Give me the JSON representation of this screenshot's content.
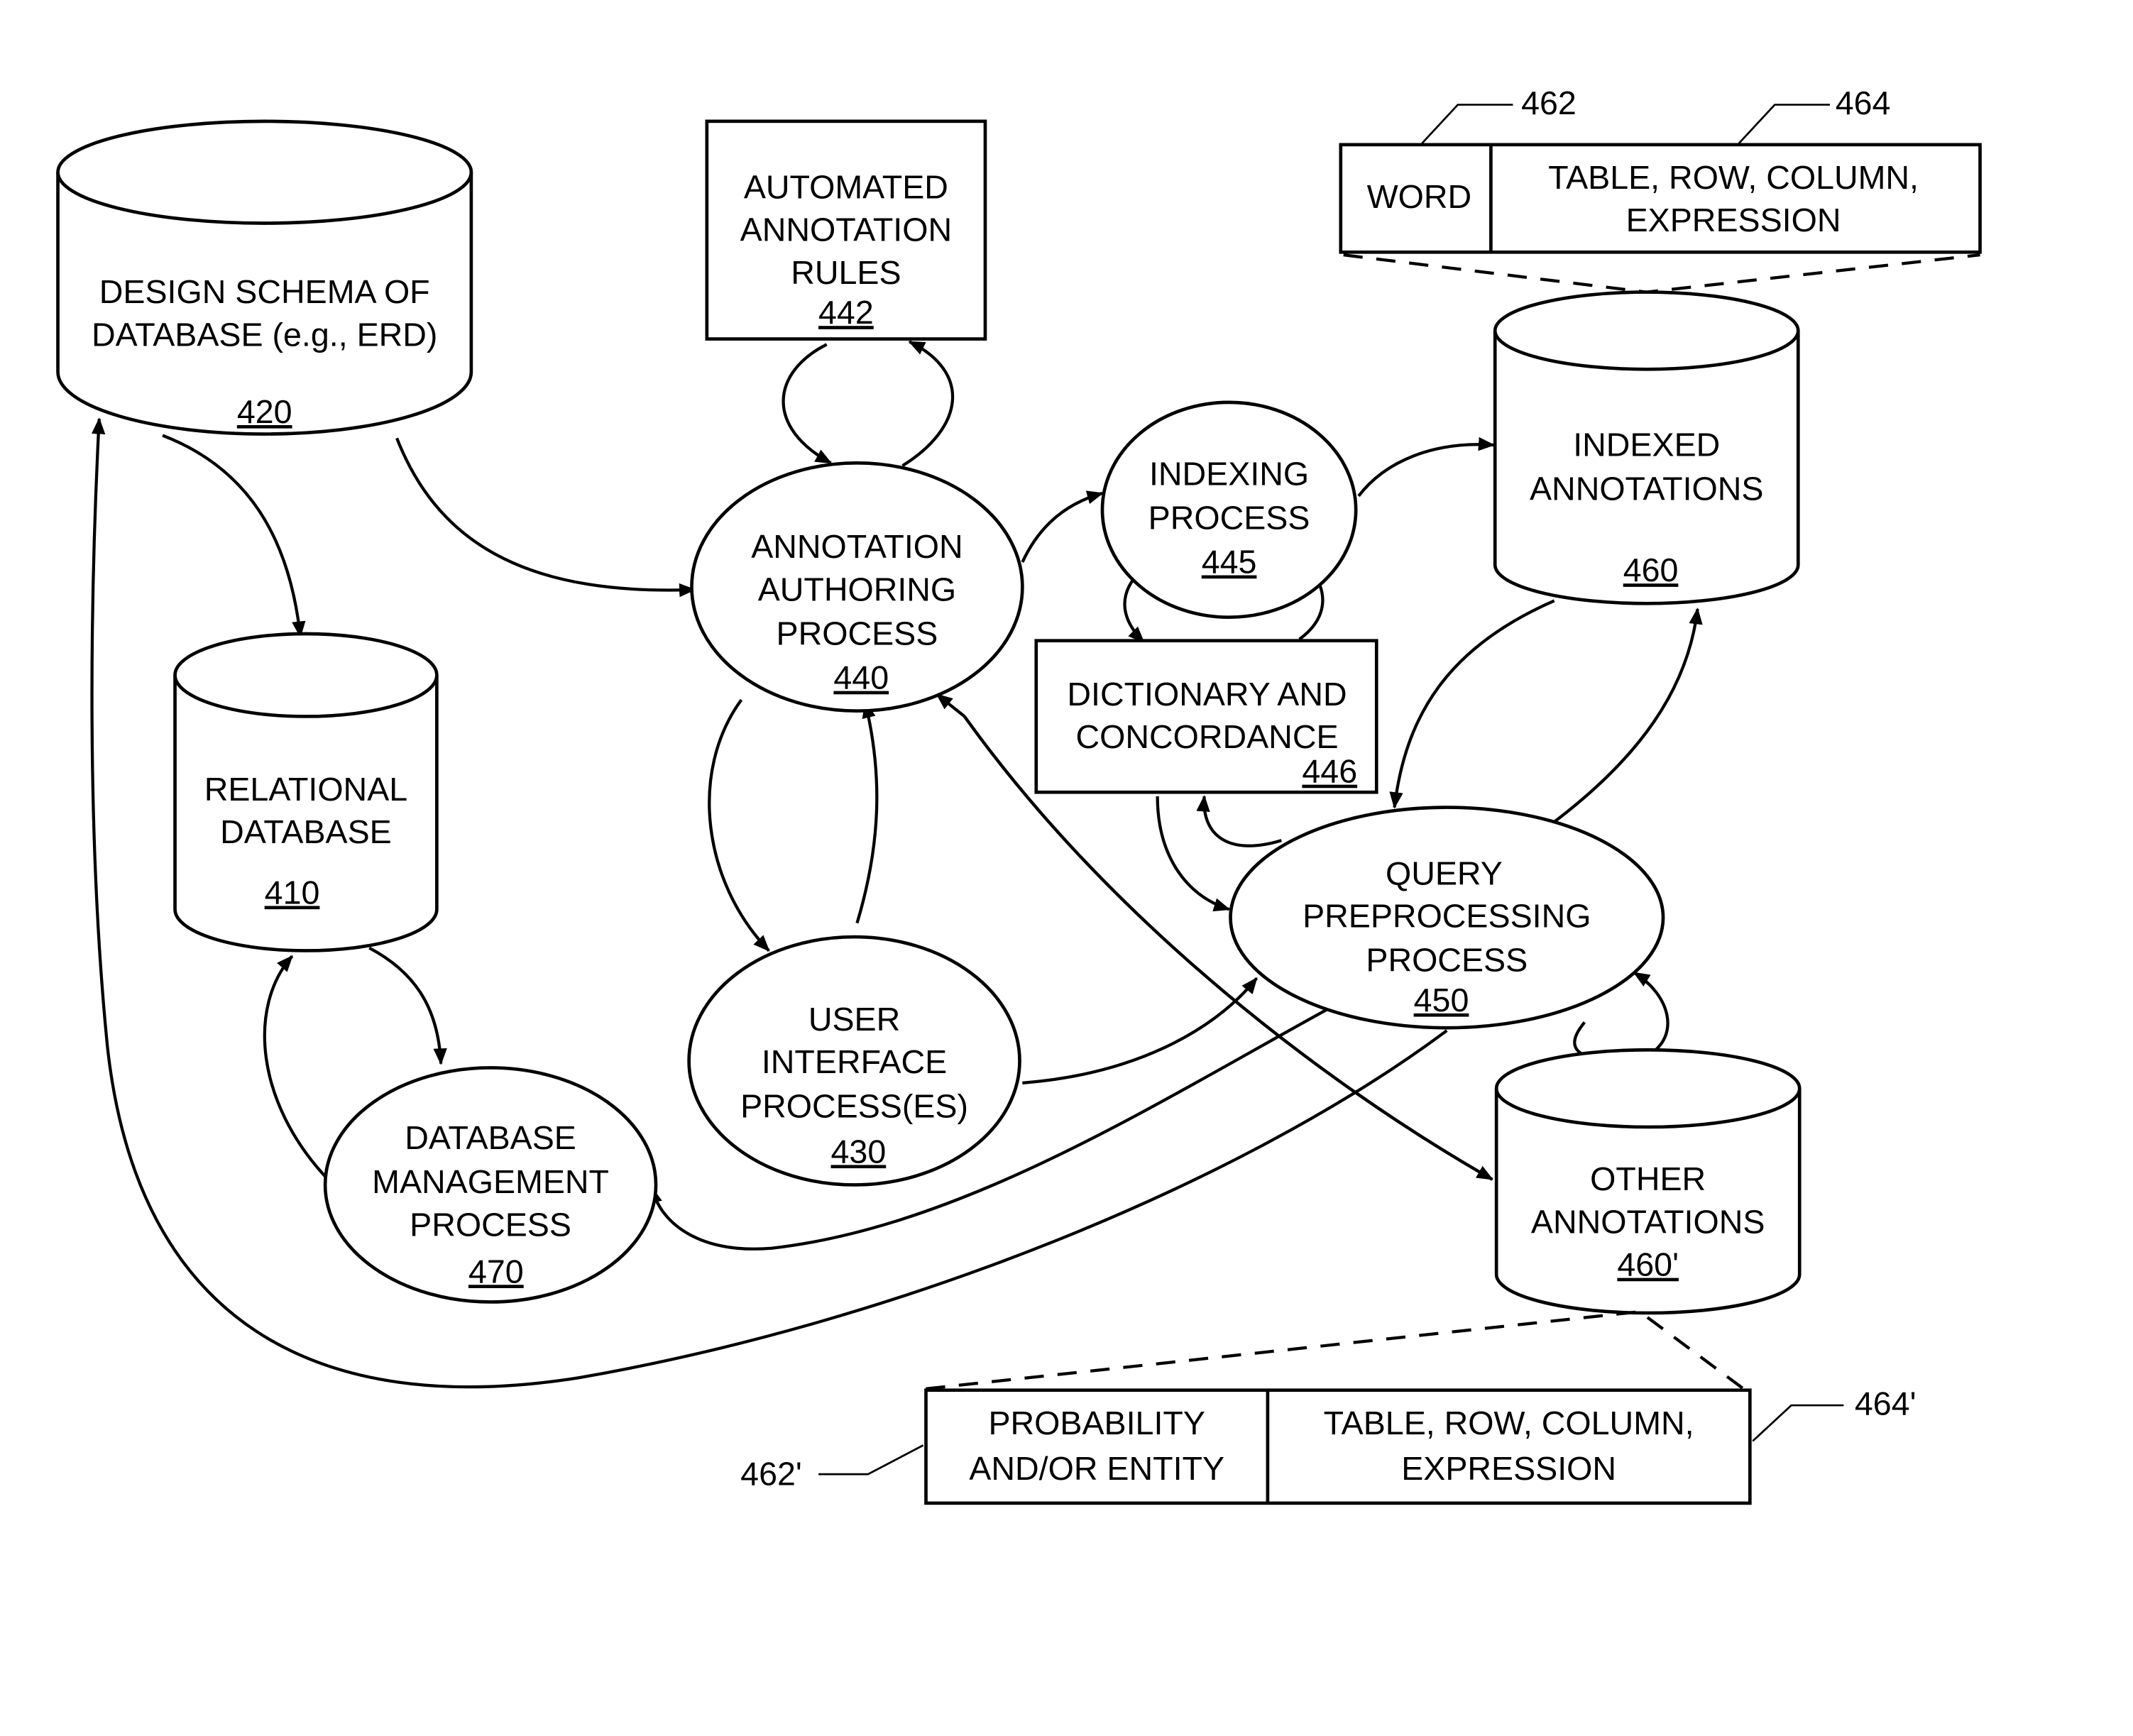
{
  "diagram": {
    "nodes": {
      "n420": {
        "lines": [
          "DESIGN SCHEMA OF",
          "DATABASE (e.g., ERD)"
        ],
        "ref": "420",
        "shape": "cylinder"
      },
      "n442": {
        "lines": [
          "AUTOMATED",
          "ANNOTATION",
          "RULES"
        ],
        "ref": "442",
        "shape": "rectangle"
      },
      "n410": {
        "lines": [
          "RELATIONAL",
          "DATABASE"
        ],
        "ref": "410",
        "shape": "cylinder"
      },
      "n440": {
        "lines": [
          "ANNOTATION",
          "AUTHORING",
          "PROCESS"
        ],
        "ref": "440",
        "shape": "ellipse"
      },
      "n445": {
        "lines": [
          "INDEXING",
          "PROCESS"
        ],
        "ref": "445",
        "shape": "ellipse"
      },
      "n446": {
        "lines": [
          "DICTIONARY AND",
          "CONCORDANCE"
        ],
        "ref": "446",
        "shape": "rectangle"
      },
      "n460": {
        "lines": [
          "INDEXED",
          "ANNOTATIONS"
        ],
        "ref": "460",
        "shape": "cylinder"
      },
      "n450": {
        "lines": [
          "QUERY",
          "PREPROCESSING",
          "PROCESS"
        ],
        "ref": "450",
        "shape": "ellipse"
      },
      "n430": {
        "lines": [
          "USER",
          "INTERFACE",
          "PROCESS(ES)"
        ],
        "ref": "430",
        "shape": "ellipse"
      },
      "n470": {
        "lines": [
          "DATABASE",
          "MANAGEMENT",
          "PROCESS"
        ],
        "ref": "470",
        "shape": "ellipse"
      },
      "n460p": {
        "lines": [
          "OTHER",
          "ANNOTATIONS"
        ],
        "ref": "460'",
        "shape": "cylinder"
      }
    },
    "records": {
      "top": {
        "cells": [
          {
            "lines": [
              "WORD"
            ]
          },
          {
            "lines": [
              "TABLE, ROW, COLUMN,",
              "EXPRESSION"
            ]
          }
        ],
        "callouts": [
          "462",
          "464"
        ]
      },
      "bottom": {
        "cells": [
          {
            "lines": [
              "PROBABILITY",
              "AND/OR ENTITY"
            ]
          },
          {
            "lines": [
              "TABLE, ROW, COLUMN,",
              "EXPRESSION"
            ]
          }
        ],
        "callouts": [
          "462'",
          "464'"
        ]
      }
    },
    "edges": [
      {
        "from": "420",
        "to": "410"
      },
      {
        "from": "420",
        "to": "440"
      },
      {
        "from": "440",
        "to": "442"
      },
      {
        "from": "442",
        "to": "440"
      },
      {
        "from": "440",
        "to": "445"
      },
      {
        "from": "445",
        "to": "460"
      },
      {
        "from": "445",
        "to": "446"
      },
      {
        "from": "446",
        "to": "445"
      },
      {
        "from": "440",
        "to": "430"
      },
      {
        "from": "430",
        "to": "440"
      },
      {
        "from": "430",
        "to": "450"
      },
      {
        "from": "446",
        "to": "450"
      },
      {
        "from": "450",
        "to": "446"
      },
      {
        "from": "460",
        "to": "450"
      },
      {
        "from": "450",
        "to": "460"
      },
      {
        "from": "450",
        "to": "460'"
      },
      {
        "from": "460'",
        "to": "450"
      },
      {
        "from": "440",
        "to": "460'"
      },
      {
        "from": "460'",
        "to": "440"
      },
      {
        "from": "410",
        "to": "470"
      },
      {
        "from": "470",
        "to": "410"
      },
      {
        "from": "450",
        "to": "470"
      },
      {
        "from": "450",
        "to": "420"
      }
    ]
  }
}
